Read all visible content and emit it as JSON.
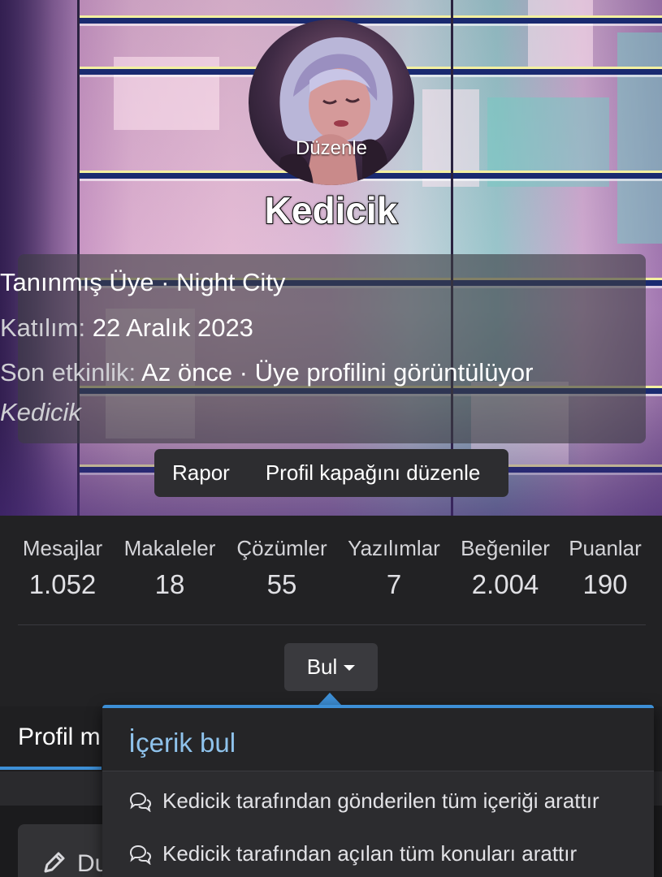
{
  "profile": {
    "avatar_edit_label": "Düzenle",
    "username": "Kedicik",
    "title_line": "Tanınmış Üye · Night City",
    "joined_label": "Katılım:",
    "joined_value": "22 Aralık 2023",
    "last_activity_label": "Son etkinlik:",
    "last_activity_value": "Az önce · Üye profilini görüntülüyor",
    "signature": "Kedicik"
  },
  "actions": {
    "report": "Rapor",
    "edit_cover": "Profil kapağını düzenle"
  },
  "stats": [
    {
      "label": "Mesajlar",
      "value": "1.052"
    },
    {
      "label": "Makaleler",
      "value": "18"
    },
    {
      "label": "Çözümler",
      "value": "55"
    },
    {
      "label": "Yazılımlar",
      "value": "7"
    },
    {
      "label": "Beğeniler",
      "value": "2.004"
    },
    {
      "label": "Puanlar",
      "value": "190"
    }
  ],
  "find_button": "Bul",
  "tabs": {
    "active": "Profil m"
  },
  "edit_button": "Du",
  "menu": {
    "title": "İçerik bul",
    "items": [
      "Kedicik tarafından gönderilen tüm içeriği arattır",
      "Kedicik tarafından açılan tüm konuları arattır"
    ]
  },
  "colors": {
    "accent": "#3d8fd6",
    "menu_title": "#8fc3ec",
    "background": "#1d1d1f"
  }
}
